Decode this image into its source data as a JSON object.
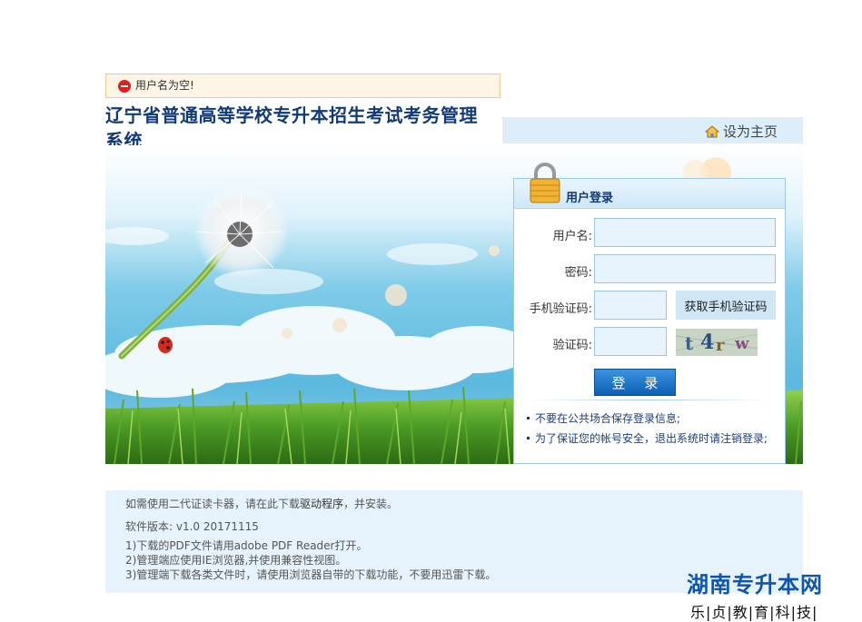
{
  "error": {
    "text": "用户名为空!"
  },
  "title": "辽宁省普通高等学校专升本招生考试考务管理系统",
  "home": {
    "label": "设为主页"
  },
  "login": {
    "header": "用户登录",
    "username_label": "用户名:",
    "username_value": "",
    "password_label": "密码:",
    "password_value": "",
    "sms_label": "手机验证码:",
    "sms_value": "",
    "sms_button": "获取手机验证码",
    "captcha_label": "验证码:",
    "captcha_value": "",
    "captcha_chars": [
      "t",
      "4",
      "r",
      "w"
    ],
    "submit": "登 录",
    "tips": [
      "不要在公共场合保存登录信息;",
      "为了保证您的帐号安全，退出系统时请注销登录;"
    ]
  },
  "info": {
    "driver_pre": "如需使用二代证读卡器，请在此下载",
    "driver_link": "驱动程序",
    "driver_post": "，并安装。",
    "version": "软件版本: v1.0 20171115",
    "notes": [
      "1)下载的PDF文件请用adobe PDF Reader打开。",
      "2)管理端应使用IE浏览器,并使用兼容性视图。",
      "3)管理端下载各类文件时，请使用浏览器自带的下载功能，不要用迅雷下载。"
    ]
  },
  "watermark": {
    "main": "湖南专升本网",
    "sub": "乐|贞|教|育|科|技|"
  },
  "colors": {
    "title": "#123a7a",
    "accent": "#0e5fb4",
    "panel_border": "#9dc8ea",
    "info_bg": "#e6f3fc"
  }
}
